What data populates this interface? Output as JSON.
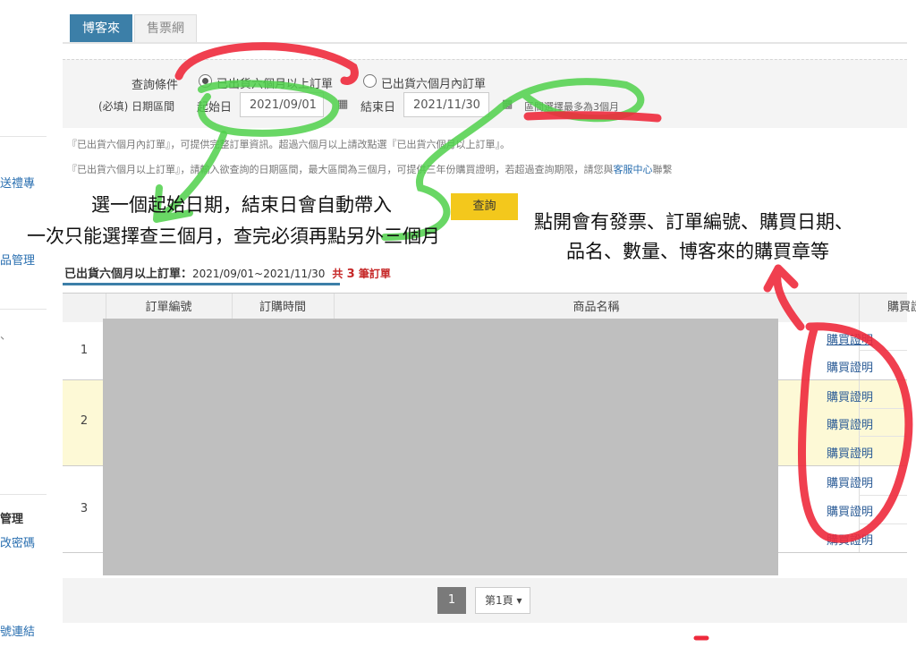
{
  "sidebar": {
    "items": [
      "送禮專",
      "品管理",
      "、",
      "管理",
      "改密碼",
      "號連結"
    ]
  },
  "tabs": [
    {
      "label": "博客來",
      "active": true
    },
    {
      "label": "售票網",
      "active": false
    }
  ],
  "query": {
    "condition_label": "查詢條件",
    "radio_options": [
      {
        "label": "已出貨六個月以上訂單",
        "checked": true
      },
      {
        "label": "已出貨六個月內訂單",
        "checked": false
      }
    ],
    "date_range_label": "(必填) 日期區間",
    "start_label": "起始日",
    "start_value": "2021/09/01",
    "end_label": "結束日",
    "end_value": "2021/11/30",
    "range_hint": "區間選擇最多為3個月",
    "button_label": "查詢"
  },
  "notes": {
    "line1": "『已出貨六個月內訂單』，可提供完整訂單資訊。超過六個月以上請改點選『已出貨六個月以上訂單』。",
    "line2_prefix": "『已出貨六個月以上訂單』，請輸入欲查詢的日期區間，最大區間為三個月，可提供三年份購買證明，若超過查詢期限，請您與",
    "line2_link": "客服中心",
    "line2_suffix": "聯繫"
  },
  "result": {
    "title": "已出貨六個月以上訂單：",
    "range": "2021/09/01~2021/11/30",
    "count_prefix": "共",
    "count": "3",
    "count_suffix": "筆訂單"
  },
  "table": {
    "headers": [
      "訂單編號",
      "訂購時間",
      "商品名稱",
      "購買證明"
    ],
    "rows": [
      {
        "num": "1",
        "links": [
          "購買證明",
          "購買證明"
        ]
      },
      {
        "num": "2",
        "links": [
          "購買證明",
          "購買證明",
          "購買證明"
        ]
      },
      {
        "num": "3",
        "links": [
          "購買證明",
          "購買證明",
          "購買證明"
        ]
      }
    ]
  },
  "pager": {
    "current": "1",
    "select_label": "第1頁 ▾"
  },
  "annotations": {
    "a1_line1": "選一個起始日期，結束日會自動帶入",
    "a1_line2": "一次只能選擇查三個月，查完必須再點另外三個月",
    "a2_line1": "點開會有發票、訂單編號、購買日期、",
    "a2_line2": "品名、數量、博客來的購買章等"
  },
  "colors": {
    "tab_active": "#3c7fa8",
    "query_button": "#f3c81c",
    "row_highlight": "#fdf9d6",
    "link": "#2a5b96",
    "marker_red": "#ee2a3c",
    "marker_green": "#4fd04a"
  }
}
